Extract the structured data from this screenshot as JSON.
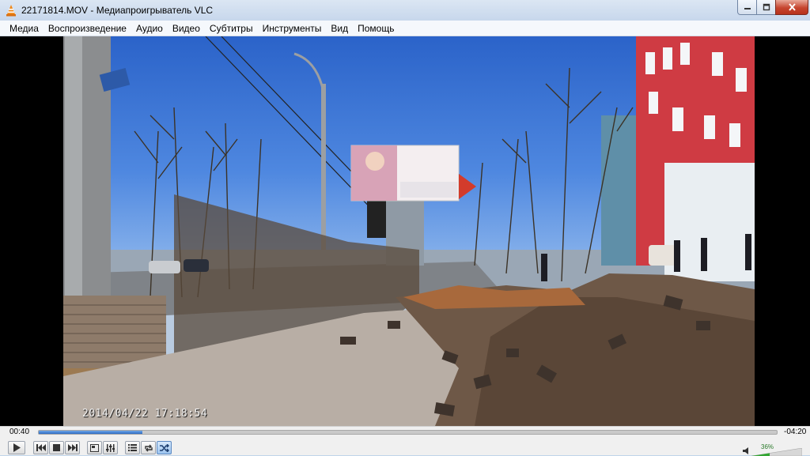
{
  "window": {
    "title": "22171814.MOV - Медиапроигрыватель VLC",
    "icon": "vlc-cone-icon"
  },
  "menu": {
    "items": [
      "Медиа",
      "Воспроизведение",
      "Аудио",
      "Видео",
      "Субтитры",
      "Инструменты",
      "Вид",
      "Помощь"
    ]
  },
  "video": {
    "timestamp": "2014/04/22  17:18:54"
  },
  "playback": {
    "elapsed": "00:40",
    "remaining": "-04:20",
    "progress": 0.14,
    "volume": "36%"
  },
  "colors": {
    "seek_fill": "#2f6cc4",
    "close_button": "#c6452f",
    "active_toggle": "#9cc4ef"
  }
}
